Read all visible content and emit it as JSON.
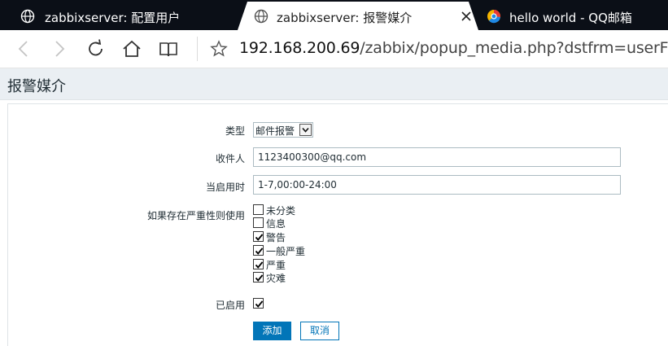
{
  "browser": {
    "tabs": [
      {
        "title": "zabbixserver: 配置用户",
        "icon": "globe-icon",
        "active": false
      },
      {
        "title": "zabbixserver: 报警媒介",
        "icon": "globe-icon",
        "active": true
      },
      {
        "title": "hello world - QQ邮箱",
        "icon": "qq-mail-icon",
        "active": false
      }
    ],
    "url_host": "192.168.200.69",
    "url_path": "/zabbix/popup_media.php?dstfrm=userForm"
  },
  "page": {
    "title": "报警媒介"
  },
  "form": {
    "type_label": "类型",
    "type_value": "邮件报警",
    "recipient_label": "收件人",
    "recipient_value": "1123400300@qq.com",
    "active_when_label": "当启用时",
    "active_when_value": "1-7,00:00-24:00",
    "severity_label": "如果存在严重性则使用",
    "severities": [
      {
        "label": "未分类",
        "checked": false
      },
      {
        "label": "信息",
        "checked": false
      },
      {
        "label": "警告",
        "checked": true
      },
      {
        "label": "一般严重",
        "checked": true
      },
      {
        "label": "严重",
        "checked": true
      },
      {
        "label": "灾难",
        "checked": true
      }
    ],
    "enabled_label": "已启用",
    "enabled_checked": true,
    "add_button": "添加",
    "cancel_button": "取消"
  },
  "colors": {
    "accent": "#0275b8",
    "header_bg": "#eaeff3",
    "tab_strip": "#0b0f17"
  }
}
